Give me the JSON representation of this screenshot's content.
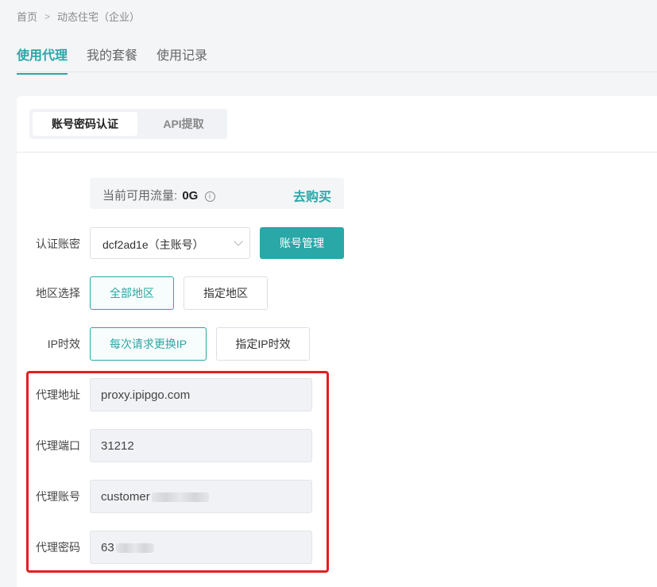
{
  "breadcrumb": {
    "home": "首页",
    "current": "动态住宅（企业）",
    "separator": ">"
  },
  "tabs": [
    {
      "label": "使用代理",
      "active": true
    },
    {
      "label": "我的套餐",
      "active": false
    },
    {
      "label": "使用记录",
      "active": false
    }
  ],
  "auth_modes": [
    {
      "label": "账号密码认证",
      "active": true
    },
    {
      "label": "API提取",
      "active": false
    }
  ],
  "balance": {
    "label": "当前可用流量:",
    "value": "0G",
    "info_icon": "i",
    "buy_label": "去购买"
  },
  "account": {
    "label": "认证账密",
    "selected": "dcf2ad1e（主账号）",
    "manage_label": "账号管理"
  },
  "region": {
    "label": "地区选择",
    "options": [
      "全部地区",
      "指定地区"
    ],
    "selected": "全部地区"
  },
  "ip_timing": {
    "label": "IP时效",
    "options": [
      "每次请求更换IP",
      "指定IP时效"
    ],
    "selected": "每次请求更换IP"
  },
  "proxy": {
    "address_label": "代理地址",
    "address": "proxy.ipipgo.com",
    "port_label": "代理端口",
    "port": "31212",
    "account_label": "代理账号",
    "account": "customer",
    "password_label": "代理密码",
    "password": "63"
  },
  "colors": {
    "accent": "#2aa7a7",
    "highlight": "#e02020"
  }
}
